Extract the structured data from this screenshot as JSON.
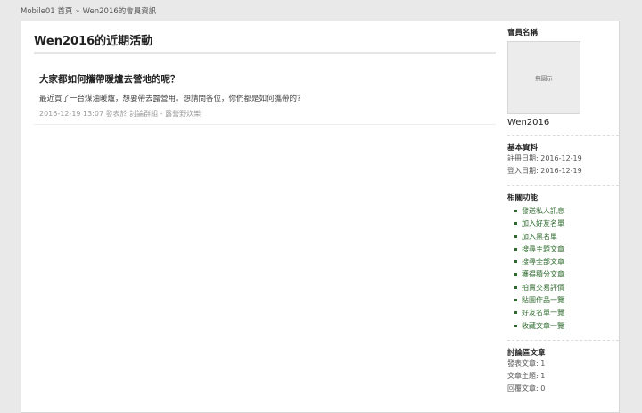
{
  "breadcrumb": {
    "home": "Mobile01 首頁",
    "separator": "»",
    "current": "Wen2016的會員資訊"
  },
  "main": {
    "title": "Wen2016的近期活動",
    "posts": [
      {
        "title": "大家都如何攜帶暖爐去營地的呢？",
        "excerpt": "最近買了一台煤油暖爐，想要帶去露營用。想請問各位，你們都是如何攜帶的?",
        "datetime": "2016-12-19 13:07",
        "posted_in": "發表於",
        "forum": "討論群組 - 露營野炊樂"
      }
    ]
  },
  "sidebar": {
    "member_heading": "會員名稱",
    "avatar_placeholder": "無圖示",
    "username": "Wen2016",
    "basic_heading": "基本資料",
    "register_date": "註冊日期: 2016-12-19",
    "login_date": "登入日期: 2016-12-19",
    "functions_heading": "相關功能",
    "functions": [
      "發送私人訊息",
      "加入好友名單",
      "加入黑名單",
      "搜尋主題文章",
      "搜尋全部文章",
      "獲得積分文章",
      "拍賣交易評價",
      "貼圖作品一覽",
      "好友名單一覽",
      "收藏文章一覽"
    ],
    "forum_heading": "討論區文章",
    "forum_stats": [
      "發表文章: 1",
      "文章主題: 1",
      "回覆文章: 0"
    ]
  },
  "colors": {
    "link_green": "#2e6b2e",
    "page_background": "#e9e9e9"
  }
}
